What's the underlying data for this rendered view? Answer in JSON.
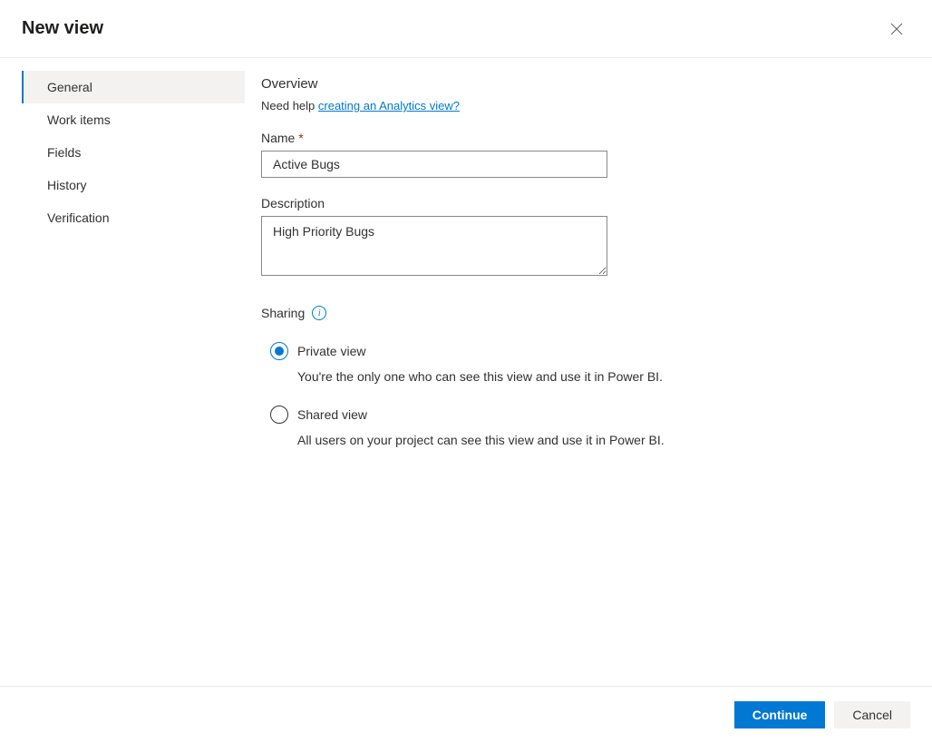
{
  "header": {
    "title": "New view"
  },
  "sidebar": {
    "items": [
      {
        "label": "General",
        "active": true
      },
      {
        "label": "Work items",
        "active": false
      },
      {
        "label": "Fields",
        "active": false
      },
      {
        "label": "History",
        "active": false
      },
      {
        "label": "Verification",
        "active": false
      }
    ]
  },
  "content": {
    "overview_title": "Overview",
    "help_prefix": "Need help ",
    "help_link": "creating an Analytics view?",
    "name_label": "Name",
    "name_value": "Active Bugs",
    "description_label": "Description",
    "description_value": "High Priority Bugs",
    "sharing_label": "Sharing",
    "radio_private_label": "Private view",
    "radio_private_desc": "You're the only one who can see this view and use it in Power BI.",
    "radio_shared_label": "Shared view",
    "radio_shared_desc": "All users on your project can see this view and use it in Power BI."
  },
  "footer": {
    "continue_label": "Continue",
    "cancel_label": "Cancel"
  }
}
